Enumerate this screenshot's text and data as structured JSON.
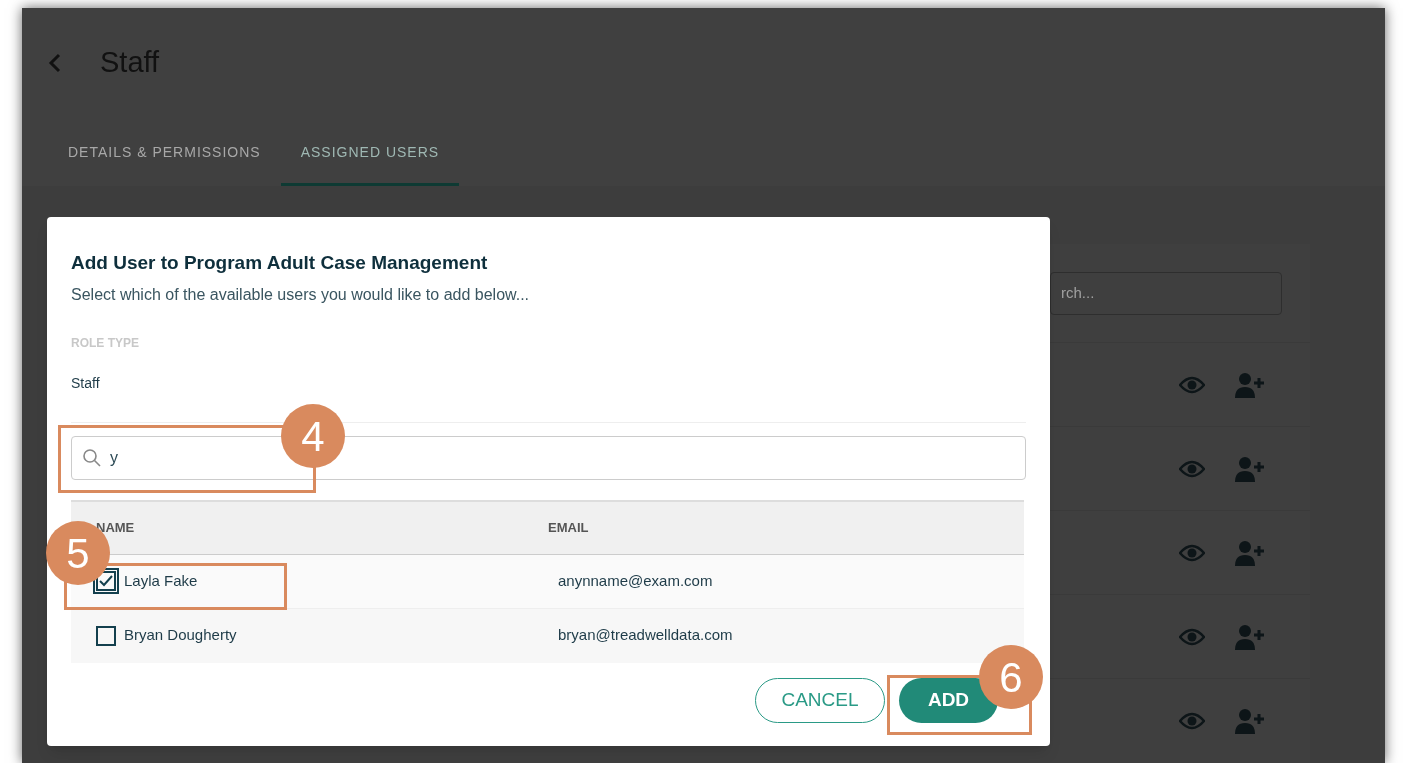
{
  "page": {
    "title": "Staff"
  },
  "tabs": [
    {
      "label": "DETAILS & PERMISSIONS",
      "selected": false
    },
    {
      "label": "ASSIGNED USERS",
      "selected": true
    }
  ],
  "background": {
    "search_placeholder": "rch...",
    "rows": [
      {
        "kind": "user-row"
      },
      {
        "kind": "user-row"
      },
      {
        "kind": "user-row"
      },
      {
        "kind": "user-row"
      },
      {
        "kind": "user-row"
      }
    ]
  },
  "dialog": {
    "title": "Add User to Program Adult Case Management",
    "subtitle": "Select which of the available users you would like to add below...",
    "role_label": "ROLE TYPE",
    "role_value": "Staff",
    "search_value": "y",
    "columns": [
      "NAME",
      "EMAIL"
    ],
    "rows": [
      {
        "name": "Layla Fake",
        "email": "anynname@exam.com",
        "checked": true
      },
      {
        "name": "Bryan Dougherty",
        "email": "bryan@treadwelldata.com",
        "checked": false
      }
    ],
    "buttons": [
      {
        "label": "CANCEL",
        "kind": "secondary"
      },
      {
        "label": "ADD",
        "kind": "primary"
      }
    ]
  },
  "callouts": [
    {
      "label": "4"
    },
    {
      "label": "5"
    },
    {
      "label": "6"
    }
  ]
}
